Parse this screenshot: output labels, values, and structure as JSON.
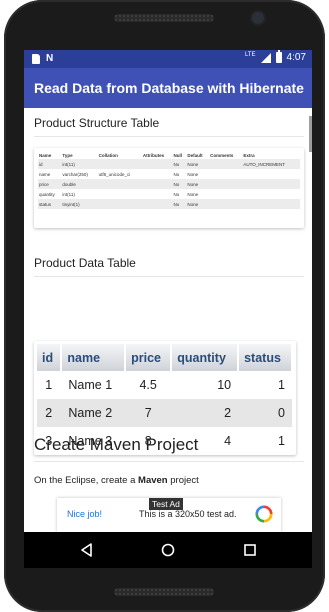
{
  "status_bar": {
    "time": "4:07",
    "left_icons": [
      "sd-card-icon",
      "n-notification-icon"
    ],
    "right_icons": [
      "lte-signal-icon",
      "battery-icon"
    ],
    "lte_label": "LTE"
  },
  "app_bar": {
    "title": "Read Data from Database with Hibernate",
    "color": "#3f51b5",
    "status_color": "#2b3f99"
  },
  "sections": {
    "structure_title": "Product Structure Table",
    "data_title": "Product Data Table",
    "maven_title": "Create Maven Project",
    "maven_text_prefix": "On the Eclipse, create a ",
    "maven_text_bold": "Maven",
    "maven_text_suffix": " project"
  },
  "structure_table": {
    "headers": [
      "Name",
      "Type",
      "Collation",
      "Attributes",
      "Null",
      "Default",
      "Comments",
      "Extra"
    ],
    "rows": [
      [
        "id",
        "int(11)",
        "",
        "",
        "No",
        "None",
        "",
        "AUTO_INCREMENT"
      ],
      [
        "name",
        "varchar(250)",
        "utf8_unicode_ci",
        "",
        "No",
        "None",
        "",
        ""
      ],
      [
        "price",
        "double",
        "",
        "",
        "No",
        "None",
        "",
        ""
      ],
      [
        "quantity",
        "int(11)",
        "",
        "",
        "No",
        "None",
        "",
        ""
      ],
      [
        "status",
        "tinyint(1)",
        "",
        "",
        "No",
        "None",
        "",
        ""
      ]
    ]
  },
  "data_table": {
    "headers": [
      "id",
      "name",
      "price",
      "quantity",
      "status"
    ],
    "rows": [
      [
        "1",
        "Name 1",
        "4.5",
        "10",
        "1"
      ],
      [
        "2",
        "Name 2",
        "7",
        "2",
        "0"
      ],
      [
        "3",
        "Name 3",
        "8",
        "4",
        "1"
      ]
    ],
    "header_color": "#2b4d7a"
  },
  "ad": {
    "tag": "Test Ad",
    "nice": "Nice job!",
    "text": "This is a 320x50 test ad."
  },
  "nav": {
    "icons": [
      "back-icon",
      "home-icon",
      "recents-icon"
    ]
  }
}
